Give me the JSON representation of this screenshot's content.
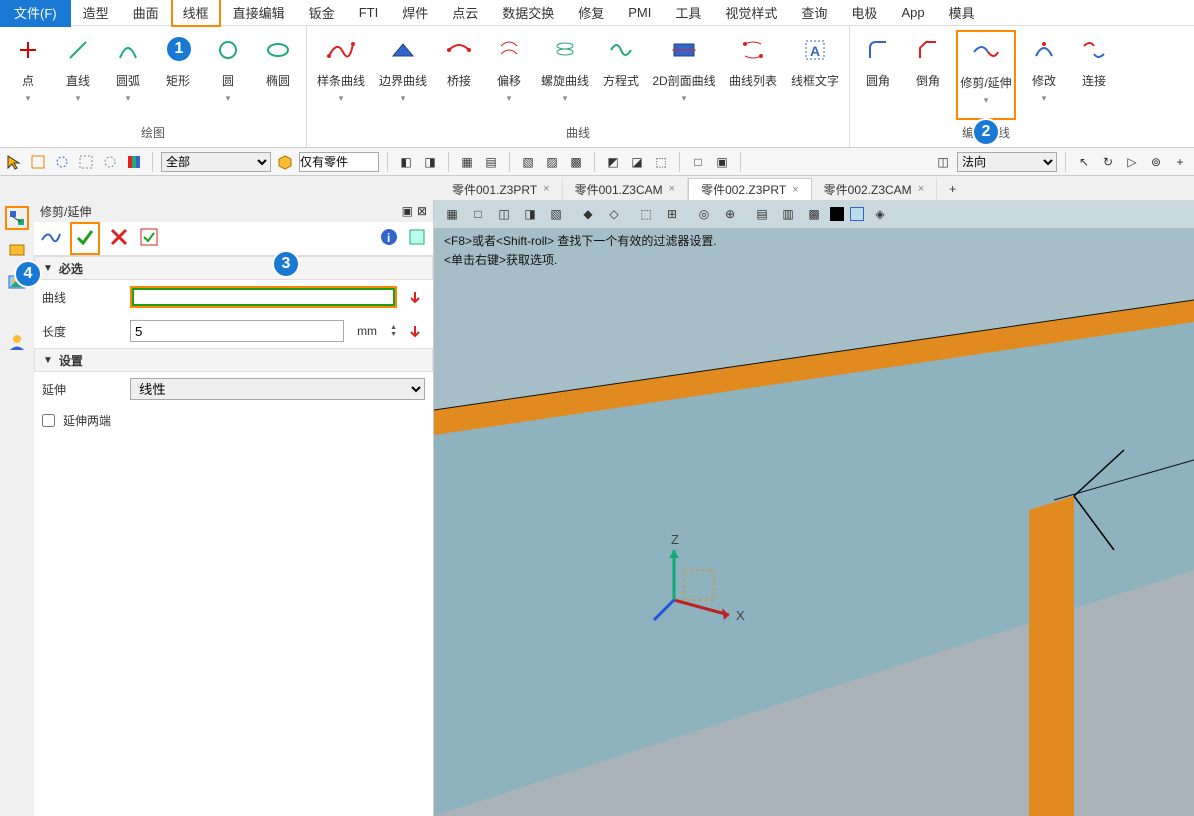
{
  "menu": {
    "file": "文件(F)",
    "items": [
      "造型",
      "曲面",
      "线框",
      "直接编辑",
      "钣金",
      "FTI",
      "焊件",
      "点云",
      "数据交换",
      "修复",
      "PMI",
      "工具",
      "视觉样式",
      "查询",
      "电极",
      "App",
      "模具"
    ],
    "active_index": 2
  },
  "ribbon": {
    "group1_label": "绘图",
    "group1": [
      "点",
      "直线",
      "圆弧",
      "矩形",
      "圆",
      "椭圆"
    ],
    "group2_label": "曲线",
    "group2": [
      "样条曲线",
      "边界曲线",
      "桥接",
      "偏移",
      "螺旋曲线",
      "方程式",
      "2D剖面曲线",
      "曲线列表",
      "线框文字"
    ],
    "group3_label": "编辑曲线",
    "group3": [
      "圆角",
      "倒角",
      "修剪/延伸",
      "修改",
      "连接"
    ],
    "highlight_index": 2
  },
  "qbar": {
    "combo1": "全部",
    "combo2": "仅有零件",
    "combo3": "法向"
  },
  "tabs": {
    "items": [
      "零件001.Z3PRT",
      "零件001.Z3CAM",
      "零件002.Z3PRT",
      "零件002.Z3CAM"
    ],
    "active_index": 2
  },
  "panel": {
    "title": "修剪/延伸",
    "sec_required": "必选",
    "row_curve": "曲线",
    "row_length": "长度",
    "length_value": "5",
    "length_unit": "mm",
    "sec_settings": "设置",
    "row_extend": "延伸",
    "extend_value": "线性",
    "chk_both": "延伸两端"
  },
  "viewport": {
    "hint1": "<F8>或者<Shift-roll> 查找下一个有效的过滤器设置.",
    "hint2": "<单击右键>获取选项.",
    "axis_x": "X",
    "axis_z": "Z"
  },
  "badges": {
    "b1": "1",
    "b2": "2",
    "b3": "3",
    "b4": "4"
  }
}
